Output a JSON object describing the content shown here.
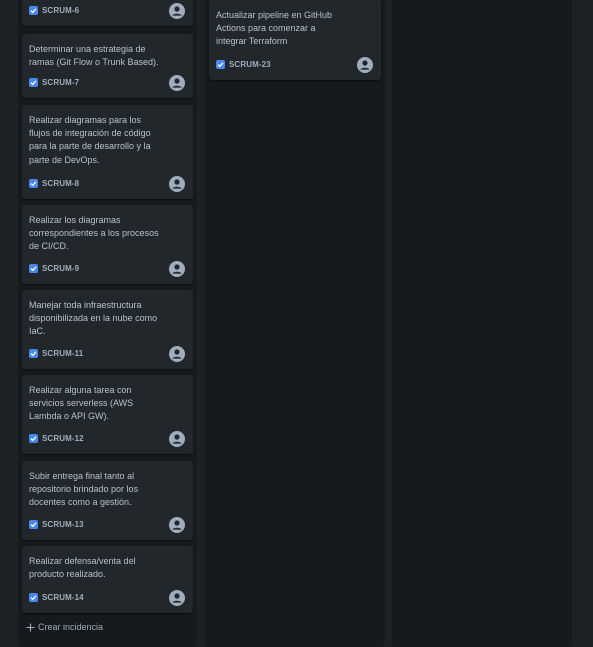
{
  "columns": [
    {
      "cards": [
        {
          "title": "",
          "key": "SCRUM-6"
        },
        {
          "title": "Determinar una estrategia de ramas (Git Flow o Trunk Based).",
          "key": "SCRUM-7"
        },
        {
          "title": "Realizar diagramas para los flujos de integración de código para la parte de desarrollo y la parte de DevOps.",
          "key": "SCRUM-8"
        },
        {
          "title": "Realizar los diagramas correspondientes a los procesos de CI/CD.",
          "key": "SCRUM-9"
        },
        {
          "title": "Manejar toda infraestructura disponibilizada en la nube como IaC.",
          "key": "SCRUM-11"
        },
        {
          "title": "Realizar alguna tarea con servicios serverless (AWS Lambda o API GW).",
          "key": "SCRUM-12"
        },
        {
          "title": "Subir entrega final tanto al repositorio brindado por los docentes como a gestión.",
          "key": "SCRUM-13"
        },
        {
          "title": "Realizar defensa/venta del producto realizado.",
          "key": "SCRUM-14"
        }
      ],
      "create_label": "Crear incidencia"
    },
    {
      "cards": [
        {
          "title": "Actualizar pipeline en GitHub Actions para comenzar a integrar Terraform",
          "key": "SCRUM-23"
        }
      ]
    },
    {
      "cards": []
    }
  ],
  "colors": {
    "background": "#1d2125",
    "column": "#161a1d",
    "card": "#22272b",
    "text": "#b6c2cf",
    "subtle_text": "#9fadbc",
    "checkbox": "#4688ec"
  },
  "icons": {
    "issue_type": "checkbox-icon",
    "assignee": "unassigned-avatar-icon",
    "create": "plus-icon"
  }
}
